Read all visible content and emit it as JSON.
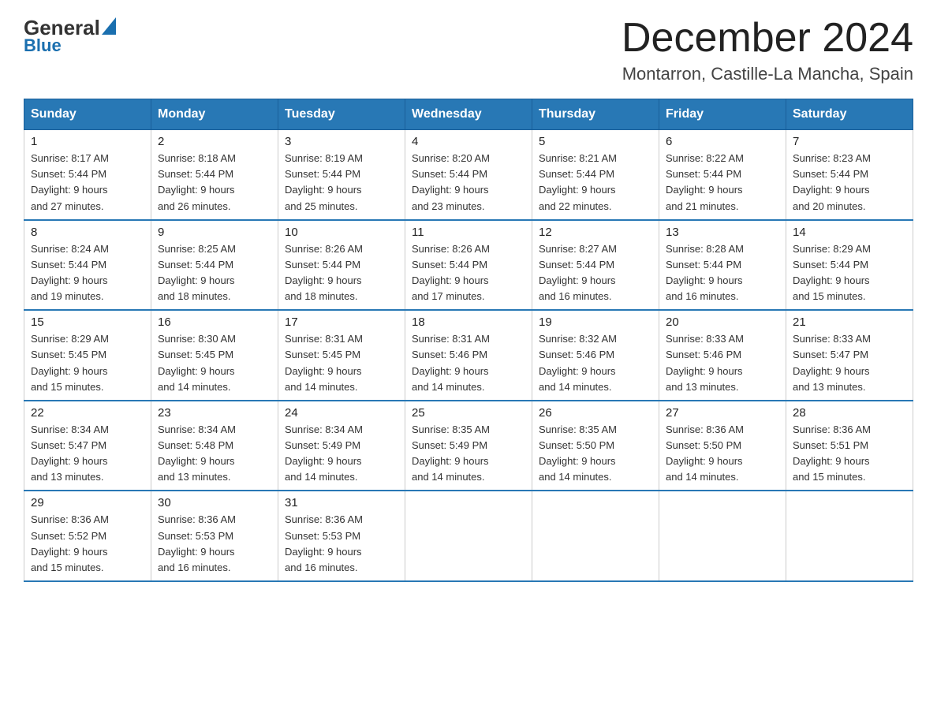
{
  "header": {
    "logo_general": "General",
    "logo_blue": "Blue",
    "month_title": "December 2024",
    "location": "Montarron, Castille-La Mancha, Spain"
  },
  "weekdays": [
    "Sunday",
    "Monday",
    "Tuesday",
    "Wednesday",
    "Thursday",
    "Friday",
    "Saturday"
  ],
  "weeks": [
    [
      {
        "day": "1",
        "sunrise": "8:17 AM",
        "sunset": "5:44 PM",
        "daylight": "9 hours and 27 minutes."
      },
      {
        "day": "2",
        "sunrise": "8:18 AM",
        "sunset": "5:44 PM",
        "daylight": "9 hours and 26 minutes."
      },
      {
        "day": "3",
        "sunrise": "8:19 AM",
        "sunset": "5:44 PM",
        "daylight": "9 hours and 25 minutes."
      },
      {
        "day": "4",
        "sunrise": "8:20 AM",
        "sunset": "5:44 PM",
        "daylight": "9 hours and 23 minutes."
      },
      {
        "day": "5",
        "sunrise": "8:21 AM",
        "sunset": "5:44 PM",
        "daylight": "9 hours and 22 minutes."
      },
      {
        "day": "6",
        "sunrise": "8:22 AM",
        "sunset": "5:44 PM",
        "daylight": "9 hours and 21 minutes."
      },
      {
        "day": "7",
        "sunrise": "8:23 AM",
        "sunset": "5:44 PM",
        "daylight": "9 hours and 20 minutes."
      }
    ],
    [
      {
        "day": "8",
        "sunrise": "8:24 AM",
        "sunset": "5:44 PM",
        "daylight": "9 hours and 19 minutes."
      },
      {
        "day": "9",
        "sunrise": "8:25 AM",
        "sunset": "5:44 PM",
        "daylight": "9 hours and 18 minutes."
      },
      {
        "day": "10",
        "sunrise": "8:26 AM",
        "sunset": "5:44 PM",
        "daylight": "9 hours and 18 minutes."
      },
      {
        "day": "11",
        "sunrise": "8:26 AM",
        "sunset": "5:44 PM",
        "daylight": "9 hours and 17 minutes."
      },
      {
        "day": "12",
        "sunrise": "8:27 AM",
        "sunset": "5:44 PM",
        "daylight": "9 hours and 16 minutes."
      },
      {
        "day": "13",
        "sunrise": "8:28 AM",
        "sunset": "5:44 PM",
        "daylight": "9 hours and 16 minutes."
      },
      {
        "day": "14",
        "sunrise": "8:29 AM",
        "sunset": "5:44 PM",
        "daylight": "9 hours and 15 minutes."
      }
    ],
    [
      {
        "day": "15",
        "sunrise": "8:29 AM",
        "sunset": "5:45 PM",
        "daylight": "9 hours and 15 minutes."
      },
      {
        "day": "16",
        "sunrise": "8:30 AM",
        "sunset": "5:45 PM",
        "daylight": "9 hours and 14 minutes."
      },
      {
        "day": "17",
        "sunrise": "8:31 AM",
        "sunset": "5:45 PM",
        "daylight": "9 hours and 14 minutes."
      },
      {
        "day": "18",
        "sunrise": "8:31 AM",
        "sunset": "5:46 PM",
        "daylight": "9 hours and 14 minutes."
      },
      {
        "day": "19",
        "sunrise": "8:32 AM",
        "sunset": "5:46 PM",
        "daylight": "9 hours and 14 minutes."
      },
      {
        "day": "20",
        "sunrise": "8:33 AM",
        "sunset": "5:46 PM",
        "daylight": "9 hours and 13 minutes."
      },
      {
        "day": "21",
        "sunrise": "8:33 AM",
        "sunset": "5:47 PM",
        "daylight": "9 hours and 13 minutes."
      }
    ],
    [
      {
        "day": "22",
        "sunrise": "8:34 AM",
        "sunset": "5:47 PM",
        "daylight": "9 hours and 13 minutes."
      },
      {
        "day": "23",
        "sunrise": "8:34 AM",
        "sunset": "5:48 PM",
        "daylight": "9 hours and 13 minutes."
      },
      {
        "day": "24",
        "sunrise": "8:34 AM",
        "sunset": "5:49 PM",
        "daylight": "9 hours and 14 minutes."
      },
      {
        "day": "25",
        "sunrise": "8:35 AM",
        "sunset": "5:49 PM",
        "daylight": "9 hours and 14 minutes."
      },
      {
        "day": "26",
        "sunrise": "8:35 AM",
        "sunset": "5:50 PM",
        "daylight": "9 hours and 14 minutes."
      },
      {
        "day": "27",
        "sunrise": "8:36 AM",
        "sunset": "5:50 PM",
        "daylight": "9 hours and 14 minutes."
      },
      {
        "day": "28",
        "sunrise": "8:36 AM",
        "sunset": "5:51 PM",
        "daylight": "9 hours and 15 minutes."
      }
    ],
    [
      {
        "day": "29",
        "sunrise": "8:36 AM",
        "sunset": "5:52 PM",
        "daylight": "9 hours and 15 minutes."
      },
      {
        "day": "30",
        "sunrise": "8:36 AM",
        "sunset": "5:53 PM",
        "daylight": "9 hours and 16 minutes."
      },
      {
        "day": "31",
        "sunrise": "8:36 AM",
        "sunset": "5:53 PM",
        "daylight": "9 hours and 16 minutes."
      },
      null,
      null,
      null,
      null
    ]
  ],
  "labels": {
    "sunrise": "Sunrise:",
    "sunset": "Sunset:",
    "daylight": "Daylight:"
  }
}
